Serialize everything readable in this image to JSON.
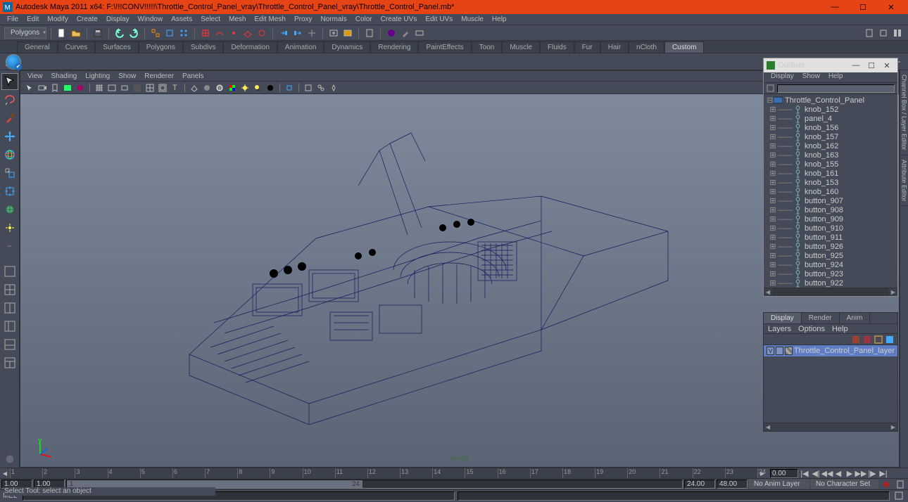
{
  "title": "Autodesk Maya 2011 x64: F:\\!!!CONV!!!!!\\Throttle_Control_Panel_vray\\Throttle_Control_Panel_vray\\Throttle_Control_Panel.mb*",
  "menu": [
    "File",
    "Edit",
    "Modify",
    "Create",
    "Display",
    "Window",
    "Assets",
    "Select",
    "Mesh",
    "Edit Mesh",
    "Proxy",
    "Normals",
    "Color",
    "Create UVs",
    "Edit UVs",
    "Muscle",
    "Help"
  ],
  "modeSelect": "Polygons",
  "shelfTabs": [
    "General",
    "Curves",
    "Surfaces",
    "Polygons",
    "Subdivs",
    "Deformation",
    "Animation",
    "Dynamics",
    "Rendering",
    "PaintEffects",
    "Toon",
    "Muscle",
    "Fluids",
    "Fur",
    "Hair",
    "nCloth",
    "Custom"
  ],
  "shelfActive": "Custom",
  "viewport": {
    "menu": [
      "View",
      "Shading",
      "Lighting",
      "Show",
      "Renderer",
      "Panels"
    ],
    "camera": "persp"
  },
  "outliner": {
    "title": "Outliner",
    "menu": [
      "Display",
      "Show",
      "Help"
    ],
    "items": [
      {
        "name": "Throttle_Control_Panel",
        "indent": 0,
        "expanded": true,
        "big": true
      },
      {
        "name": "knob_152",
        "indent": 1
      },
      {
        "name": "panel_4",
        "indent": 1
      },
      {
        "name": "knob_156",
        "indent": 1
      },
      {
        "name": "knob_157",
        "indent": 1
      },
      {
        "name": "knob_162",
        "indent": 1
      },
      {
        "name": "knob_163",
        "indent": 1
      },
      {
        "name": "knob_155",
        "indent": 1
      },
      {
        "name": "knob_161",
        "indent": 1
      },
      {
        "name": "knob_153",
        "indent": 1
      },
      {
        "name": "knob_160",
        "indent": 1
      },
      {
        "name": "button_907",
        "indent": 1
      },
      {
        "name": "button_908",
        "indent": 1
      },
      {
        "name": "button_909",
        "indent": 1
      },
      {
        "name": "button_910",
        "indent": 1
      },
      {
        "name": "button_911",
        "indent": 1
      },
      {
        "name": "button_926",
        "indent": 1
      },
      {
        "name": "button_925",
        "indent": 1
      },
      {
        "name": "button_924",
        "indent": 1
      },
      {
        "name": "button_923",
        "indent": 1
      },
      {
        "name": "button_922",
        "indent": 1
      }
    ]
  },
  "layerTabs": [
    "Display",
    "Render",
    "Anim"
  ],
  "layerActive": "Display",
  "layerMenu": [
    "Layers",
    "Options",
    "Help"
  ],
  "layers": [
    {
      "v": "V",
      "name": "Throttle_Control_Panel_layer"
    }
  ],
  "rightTabs": [
    "Channel Box / Layer Editor",
    "Attribute Editor"
  ],
  "time": {
    "current": "0.00",
    "start": "1.00",
    "startB": "1.00",
    "end": "24.00",
    "endB": "48.00",
    "animLayer": "No Anim Layer",
    "charSet": "No Character Set",
    "rgStart": "1",
    "rgEnd": "24"
  },
  "cmd": {
    "lang": "MEL"
  },
  "helpline": "Select Tool: select an object"
}
